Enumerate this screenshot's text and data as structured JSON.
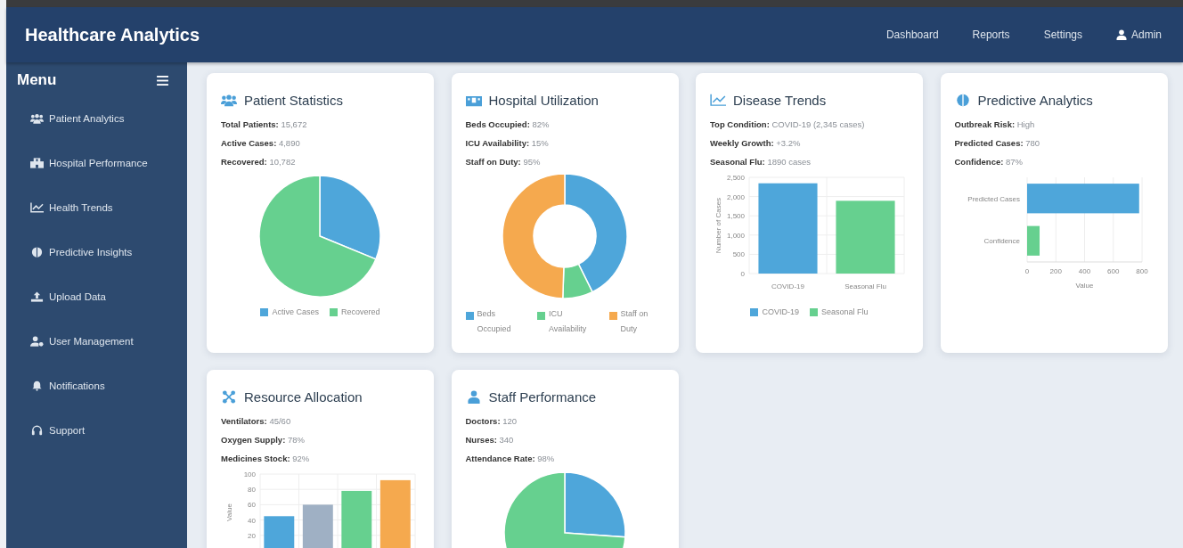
{
  "header": {
    "title": "Healthcare Analytics",
    "nav": [
      {
        "label": "Dashboard",
        "kind": "link"
      },
      {
        "label": "Reports",
        "kind": "link"
      },
      {
        "label": "Settings",
        "kind": "link"
      },
      {
        "label": "Admin",
        "kind": "user"
      }
    ]
  },
  "sidebar": {
    "title": "Menu",
    "items": [
      {
        "label": "Patient Analytics"
      },
      {
        "label": "Hospital Performance"
      },
      {
        "label": "Health Trends"
      },
      {
        "label": "Predictive Insights"
      },
      {
        "label": "Upload Data"
      },
      {
        "label": "User Management"
      },
      {
        "label": "Notifications"
      },
      {
        "label": "Support"
      }
    ]
  },
  "cards": [
    {
      "title": "Patient Statistics",
      "stats": [
        "**Total Patients:** 15,672",
        "**Active Cases:** 4,890",
        "**Recovered:** 10,782"
      ],
      "chart_data": {
        "type": "pie",
        "categories": [
          "Active Cases",
          "Recovered"
        ],
        "values": [
          31.2,
          68.8
        ],
        "colors": [
          "#4ea6da",
          "#66d08f"
        ]
      }
    },
    {
      "title": "Hospital Utilization",
      "stats": [
        "**Beds Occupied:** 82%",
        "**ICU Availability:** 15%",
        "**Staff on Duty:** 95%"
      ],
      "chart_data": {
        "type": "donut",
        "categories": [
          "Beds Occupied",
          "ICU Availability",
          "Staff on Duty"
        ],
        "values": [
          42.7,
          7.8,
          49.5
        ],
        "colors": [
          "#4ea6da",
          "#66d08f",
          "#f5a94e"
        ]
      }
    },
    {
      "title": "Disease Trends",
      "stats": [
        "**Top Condition:** COVID-19 (2,345 cases)",
        "**Weekly Growth:** +3.2%",
        "**Seasonal Flu:** 1890 cases"
      ],
      "chart_data": {
        "type": "bar",
        "orientation": "vertical",
        "ylabel": "Number of Cases",
        "grid": true,
        "categories": [
          "COVID-19",
          "Seasonal Flu"
        ],
        "ylim": [
          0,
          2500
        ],
        "yticks": [
          {
            "value": 0,
            "label": "0"
          },
          {
            "value": 500,
            "label": "500"
          },
          {
            "value": 1000,
            "label": "1,000"
          },
          {
            "value": 1500,
            "label": "1,500"
          },
          {
            "value": 2000,
            "label": "2,000"
          },
          {
            "value": 2500,
            "label": "2,500"
          }
        ],
        "series": [
          {
            "name": "COVID-19",
            "color": "#4ea6da",
            "values": [
              2345,
              null
            ]
          },
          {
            "name": "Seasonal Flu",
            "color": "#66d08f",
            "values": [
              null,
              1890
            ]
          }
        ]
      }
    },
    {
      "title": "Predictive Analytics",
      "stats": [
        "**Outbreak Risk:** High",
        "**Predicted Cases:** 780",
        "**Confidence:** 87%"
      ],
      "chart_data": {
        "type": "bar",
        "orientation": "horizontal",
        "xlabel": "Value",
        "grid": true,
        "categories": [
          "Predicted Cases",
          "Confidence"
        ],
        "values": [
          780,
          87
        ],
        "colors": [
          "#4ea6da",
          "#66d08f"
        ],
        "xlim": [
          0,
          800
        ],
        "xticks": [
          0,
          200,
          400,
          600,
          800
        ]
      }
    },
    {
      "title": "Resource Allocation",
      "stats": [
        "**Ventilators:** 45/60",
        "**Oxygen Supply:** 78%",
        "**Medicines Stock:** 92%"
      ],
      "chart_data": {
        "type": "bar",
        "orientation": "vertical",
        "ylabel": "Value",
        "grid": true,
        "ylim": [
          0,
          100
        ],
        "yticks": [
          20,
          40,
          60,
          80,
          100
        ],
        "values": [
          45,
          60,
          78,
          92
        ],
        "colors": [
          "#4ea6da",
          "#9fb0c4",
          "#66d08f",
          "#f5a94e"
        ]
      }
    },
    {
      "title": "Staff Performance",
      "stats": [
        "**Doctors:** 120",
        "**Nurses:** 340",
        "**Attendance Rate:** 98%"
      ],
      "chart_data": {
        "type": "pie",
        "values": [
          26.1,
          73.9
        ],
        "colors": [
          "#4ea6da",
          "#66d08f"
        ]
      }
    }
  ]
}
